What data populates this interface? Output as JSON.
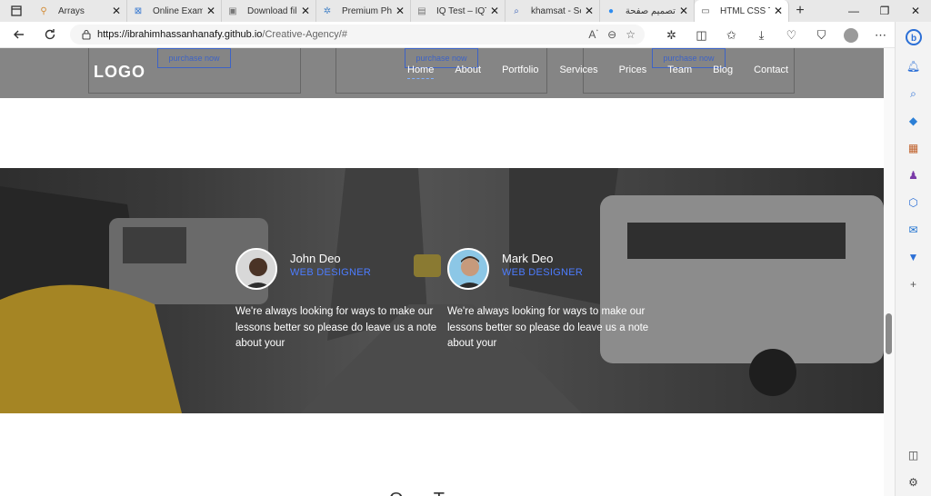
{
  "tabs": [
    {
      "title": "Arrays",
      "icon": "code-icon",
      "icon_glyph": "⚲",
      "close": "✕"
    },
    {
      "title": "Online Exam",
      "icon": "code-icon",
      "icon_glyph": "⊠",
      "close": "✕"
    },
    {
      "title": "Download file",
      "icon": "file-icon",
      "icon_glyph": "▣",
      "close": "✕"
    },
    {
      "title": "Premium Pho",
      "icon": "gear-icon",
      "icon_glyph": "✲",
      "close": "✕"
    },
    {
      "title": "IQ Test – IQTe",
      "icon": "page-icon",
      "icon_glyph": "▤",
      "close": "✕"
    },
    {
      "title": "khamsat - Sea",
      "icon": "search-icon",
      "icon_glyph": "⌕",
      "close": "✕"
    },
    {
      "title": "تصميم صفحة",
      "icon": "circle-icon",
      "icon_glyph": "●",
      "close": "✕"
    },
    {
      "title": "HTML CSS Te",
      "icon": "document-icon",
      "icon_glyph": "▭",
      "close": "✕"
    }
  ],
  "new_tab_glyph": "+",
  "window_controls": {
    "minimize": "—",
    "restore": "❐",
    "close": "✕"
  },
  "address": {
    "host": "https://ibrahimhassanhanafy.github.io",
    "path": "/Creative-Agency/#"
  },
  "site": {
    "logo": "LOGO",
    "purchase_buttons": [
      "purchase now",
      "purchase now",
      "purchase now"
    ],
    "menu": [
      "Home",
      "About",
      "Portfolio",
      "Services",
      "Prices",
      "Team",
      "Blog",
      "Contact"
    ],
    "testimonials": [
      {
        "name": "John Deo",
        "role": "WEB DESIGNER",
        "quote": "We're always looking for ways to make our lessons better so please do leave us a note about your"
      },
      {
        "name": "Mark Deo",
        "role": "WEB DESIGNER",
        "quote": "We're always looking for ways to make our lessons better so please do leave us a note about your"
      }
    ],
    "next_section_title": "O T"
  },
  "colors": {
    "accent": "#4c7cff",
    "header": "#858585",
    "purchase": "#3d63c6"
  }
}
